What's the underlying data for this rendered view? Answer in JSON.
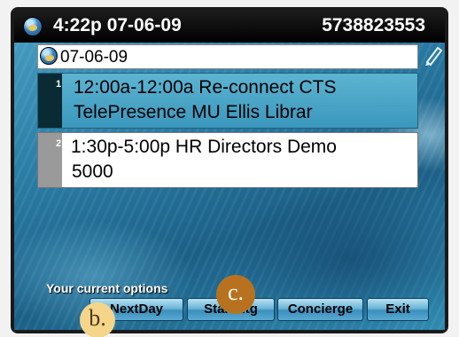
{
  "status_bar": {
    "time_date": "4:22p 07-06-09",
    "phone_number": "5738823553",
    "globe_icon": "globe-icon"
  },
  "calendar": {
    "date": "07-06-09",
    "entries": [
      {
        "index": "1",
        "line1": "12:00a-12:00a Re-connect CTS",
        "line2": "TelePresence MU Ellis Librar",
        "selected": true
      },
      {
        "index": "2",
        "line1": "1:30p-5:00p HR Directors Demo",
        "line2": "5000",
        "selected": false
      }
    ]
  },
  "options": {
    "label": "Your current options"
  },
  "softkeys": {
    "nextday": "NextDay",
    "startmtg": "StartMtg",
    "concierge": "Concierge",
    "exit": "Exit"
  },
  "callouts": {
    "b": "b.",
    "c": "c."
  },
  "colors": {
    "selected_row": "#4aa6c8",
    "softkey": "#6cb6d8",
    "callout_b": "#f5d58a",
    "callout_c": "#b8721f"
  }
}
